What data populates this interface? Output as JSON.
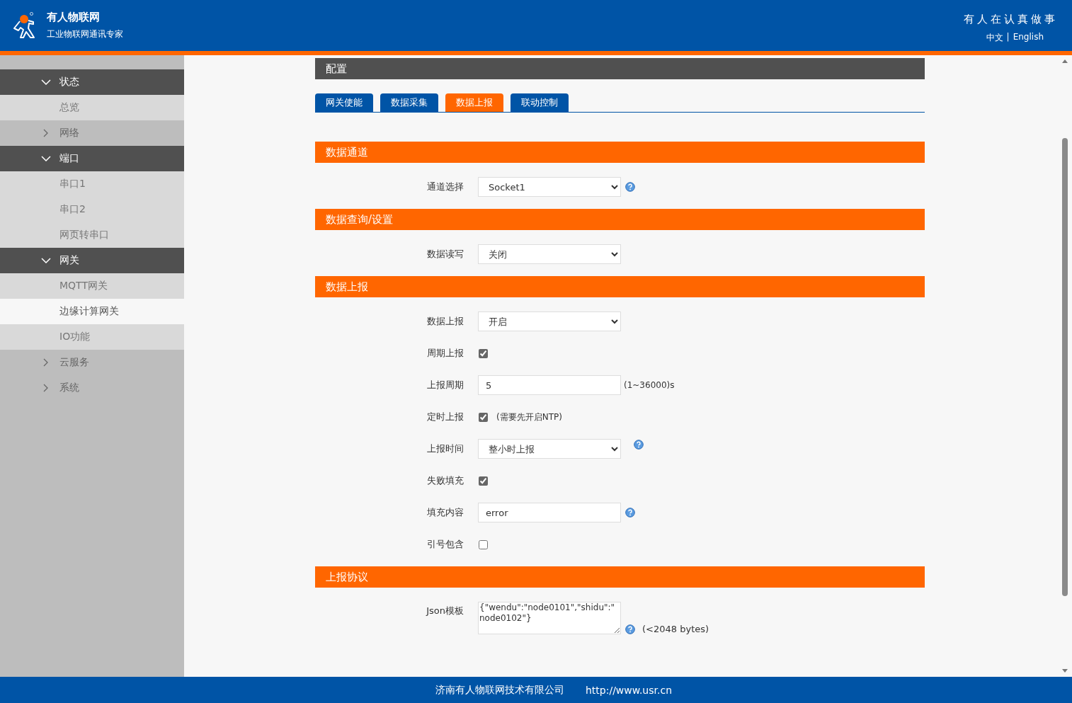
{
  "header": {
    "brand": "有人物联网",
    "tagline": "工业物联网通讯专家",
    "slogan": "有人在认真做事",
    "languages": [
      {
        "label": "中文"
      },
      {
        "label": "English"
      }
    ],
    "language_separator": "|"
  },
  "sidebar": {
    "groups": [
      {
        "label": "状态",
        "expanded": true,
        "children": [
          {
            "label": "总览",
            "selected": false
          }
        ]
      },
      {
        "label": "网络",
        "expanded": false
      },
      {
        "label": "端口",
        "expanded": true,
        "children": [
          {
            "label": "串口1",
            "selected": false
          },
          {
            "label": "串口2",
            "selected": false
          },
          {
            "label": "网页转串口",
            "selected": false
          }
        ]
      },
      {
        "label": "网关",
        "expanded": true,
        "children": [
          {
            "label": "MQTT网关",
            "selected": false
          },
          {
            "label": "边缘计算网关",
            "selected": true
          },
          {
            "label": "IO功能",
            "selected": false
          }
        ]
      },
      {
        "label": "云服务",
        "expanded": false
      },
      {
        "label": "系统",
        "expanded": false
      }
    ]
  },
  "panel": {
    "title": "配置",
    "tabs": [
      {
        "label": "网关使能",
        "selected": false
      },
      {
        "label": "数据采集",
        "selected": false
      },
      {
        "label": "数据上报",
        "selected": true
      },
      {
        "label": "联动控制",
        "selected": false
      }
    ],
    "sections": [
      {
        "title": "数据通道",
        "rows": [
          {
            "kind": "select",
            "label": "通道选择",
            "value": "Socket1",
            "help": true
          }
        ]
      },
      {
        "title": "数据查询/设置",
        "rows": [
          {
            "kind": "select",
            "label": "数据读写",
            "value": "关闭",
            "help": false
          }
        ]
      },
      {
        "title": "数据上报",
        "rows": [
          {
            "kind": "select",
            "label": "数据上报",
            "value": "开启",
            "help": false
          },
          {
            "kind": "checkbox",
            "label": "周期上报",
            "checked": true
          },
          {
            "kind": "input",
            "label": "上报周期",
            "value": "5",
            "note": "(1~36000)s"
          },
          {
            "kind": "checkbox",
            "label": "定时上报",
            "checked": true,
            "note": "(需要先开启NTP)"
          },
          {
            "kind": "select",
            "label": "上报时间",
            "value": "整小时上报",
            "help": true
          },
          {
            "kind": "checkbox",
            "label": "失败填充",
            "checked": true
          },
          {
            "kind": "input",
            "label": "填充内容",
            "value": "error",
            "help": true
          },
          {
            "kind": "checkbox",
            "label": "引号包含",
            "checked": false
          }
        ]
      },
      {
        "title": "上报协议",
        "rows": [
          {
            "kind": "textarea",
            "label": "Json模板",
            "value": "{\"wendu\":\"node0101\",\"shidu\":\"node0102\"}",
            "help": true,
            "note": "(<2048 bytes)"
          }
        ]
      }
    ]
  },
  "footer": {
    "company": "济南有人物联网技术有限公司",
    "url": "http://www.usr.cn"
  }
}
